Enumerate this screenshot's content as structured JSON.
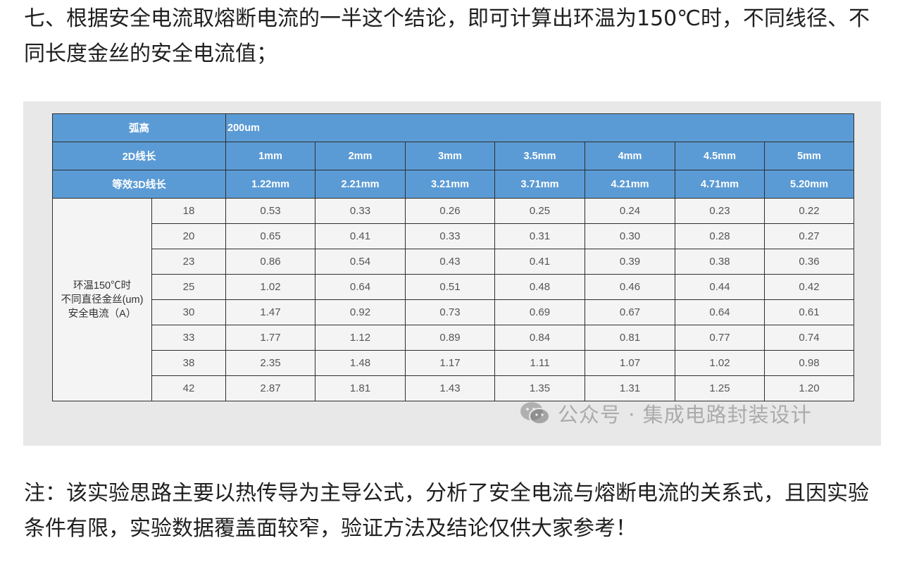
{
  "intro_text": "七、根据安全电流取熔断电流的一半这个结论，即可计算出环温为150℃时，不同线径、不同长度金丝的安全电流值；",
  "note_text": "注：该实验思路主要以热传导为主导公式，分析了安全电流与熔断电流的关系式，且因实验条件有限，实验数据覆盖面较窄，验证方法及结论仅供大家参考！",
  "table": {
    "arc_height_label": "弧高",
    "arc_height_value": "200um",
    "line_length_label": "2D线长",
    "line_lengths": [
      "1mm",
      "2mm",
      "3mm",
      "3.5mm",
      "4mm",
      "4.5mm",
      "5mm"
    ],
    "equiv_length_label": "等效3D线长",
    "equiv_lengths": [
      "1.22mm",
      "2.21mm",
      "3.21mm",
      "3.71mm",
      "4.21mm",
      "4.71mm",
      "5.20mm"
    ],
    "group_label_line1": "环温150℃时",
    "group_label_line2": "不同直径金丝(um)",
    "group_label_line3": "安全电流（A）",
    "rows": [
      {
        "diameter": "18",
        "values": [
          "0.53",
          "0.33",
          "0.26",
          "0.25",
          "0.24",
          "0.23",
          "0.22"
        ]
      },
      {
        "diameter": "20",
        "values": [
          "0.65",
          "0.41",
          "0.33",
          "0.31",
          "0.30",
          "0.28",
          "0.27"
        ]
      },
      {
        "diameter": "23",
        "values": [
          "0.86",
          "0.54",
          "0.43",
          "0.41",
          "0.39",
          "0.38",
          "0.36"
        ]
      },
      {
        "diameter": "25",
        "values": [
          "1.02",
          "0.64",
          "0.51",
          "0.48",
          "0.46",
          "0.44",
          "0.42"
        ]
      },
      {
        "diameter": "30",
        "values": [
          "1.47",
          "0.92",
          "0.73",
          "0.69",
          "0.67",
          "0.64",
          "0.61"
        ]
      },
      {
        "diameter": "33",
        "values": [
          "1.77",
          "1.12",
          "0.89",
          "0.84",
          "0.81",
          "0.77",
          "0.74"
        ]
      },
      {
        "diameter": "38",
        "values": [
          "2.35",
          "1.48",
          "1.17",
          "1.11",
          "1.07",
          "1.02",
          "0.98"
        ]
      },
      {
        "diameter": "42",
        "values": [
          "2.87",
          "1.81",
          "1.43",
          "1.35",
          "1.31",
          "1.25",
          "1.20"
        ]
      }
    ]
  },
  "watermark": {
    "icon": "wechat-icon",
    "text": "公众号 · 集成电路封装设计"
  },
  "colors": {
    "header_bg": "#5b9bd5",
    "header_text": "#ffffff",
    "figure_bg": "#e8e8e8"
  }
}
